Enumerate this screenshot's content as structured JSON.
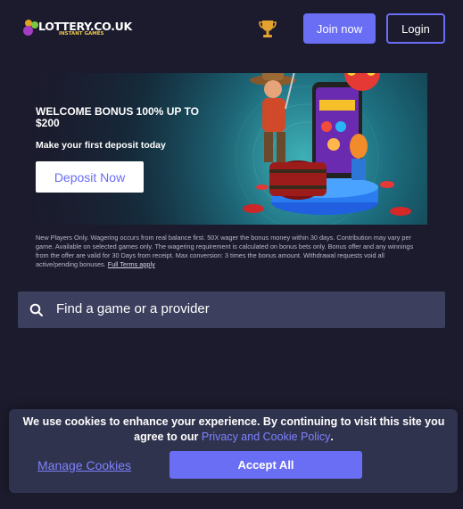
{
  "header": {
    "logo_text": "LOTTERY.CO.UK",
    "logo_sub": "INSTANT GAMES",
    "trophy_icon": "trophy-icon",
    "join_label": "Join now",
    "login_label": "Login"
  },
  "banner": {
    "title": "WELCOME BONUS 100% UP TO $200",
    "subtitle": "Make your first deposit today",
    "deposit_label": "Deposit Now"
  },
  "terms": {
    "text": "New Players Only. Wagering occurs from real balance first. 50X wager the bonus money within 30 days. Contribution may vary per game. Available on selected games only. The wagering requirement is calculated on bonus bets only. Bonus offer and any winnings from the offer are valid for 30 Days from receipt. Max conversion: 3 times the bonus amount. Withdrawal requests void all active/pending bonuses.",
    "link_label": "Full Terms apply"
  },
  "search": {
    "placeholder": "Find a game or a provider",
    "icon": "search-icon"
  },
  "cookie": {
    "text": "We use cookies to enhance your experience. By continuing to visit this site you agree to our",
    "link_label": "Privacy and Cookie Policy",
    "manage_label": "Manage Cookies",
    "accept_label": "Accept All"
  },
  "colors": {
    "background": "#1b1b2d",
    "accent": "#6a6ef5",
    "link": "#7d82ff",
    "search_bg": "#3c3f5e",
    "cookie_bg": "#30334d"
  }
}
